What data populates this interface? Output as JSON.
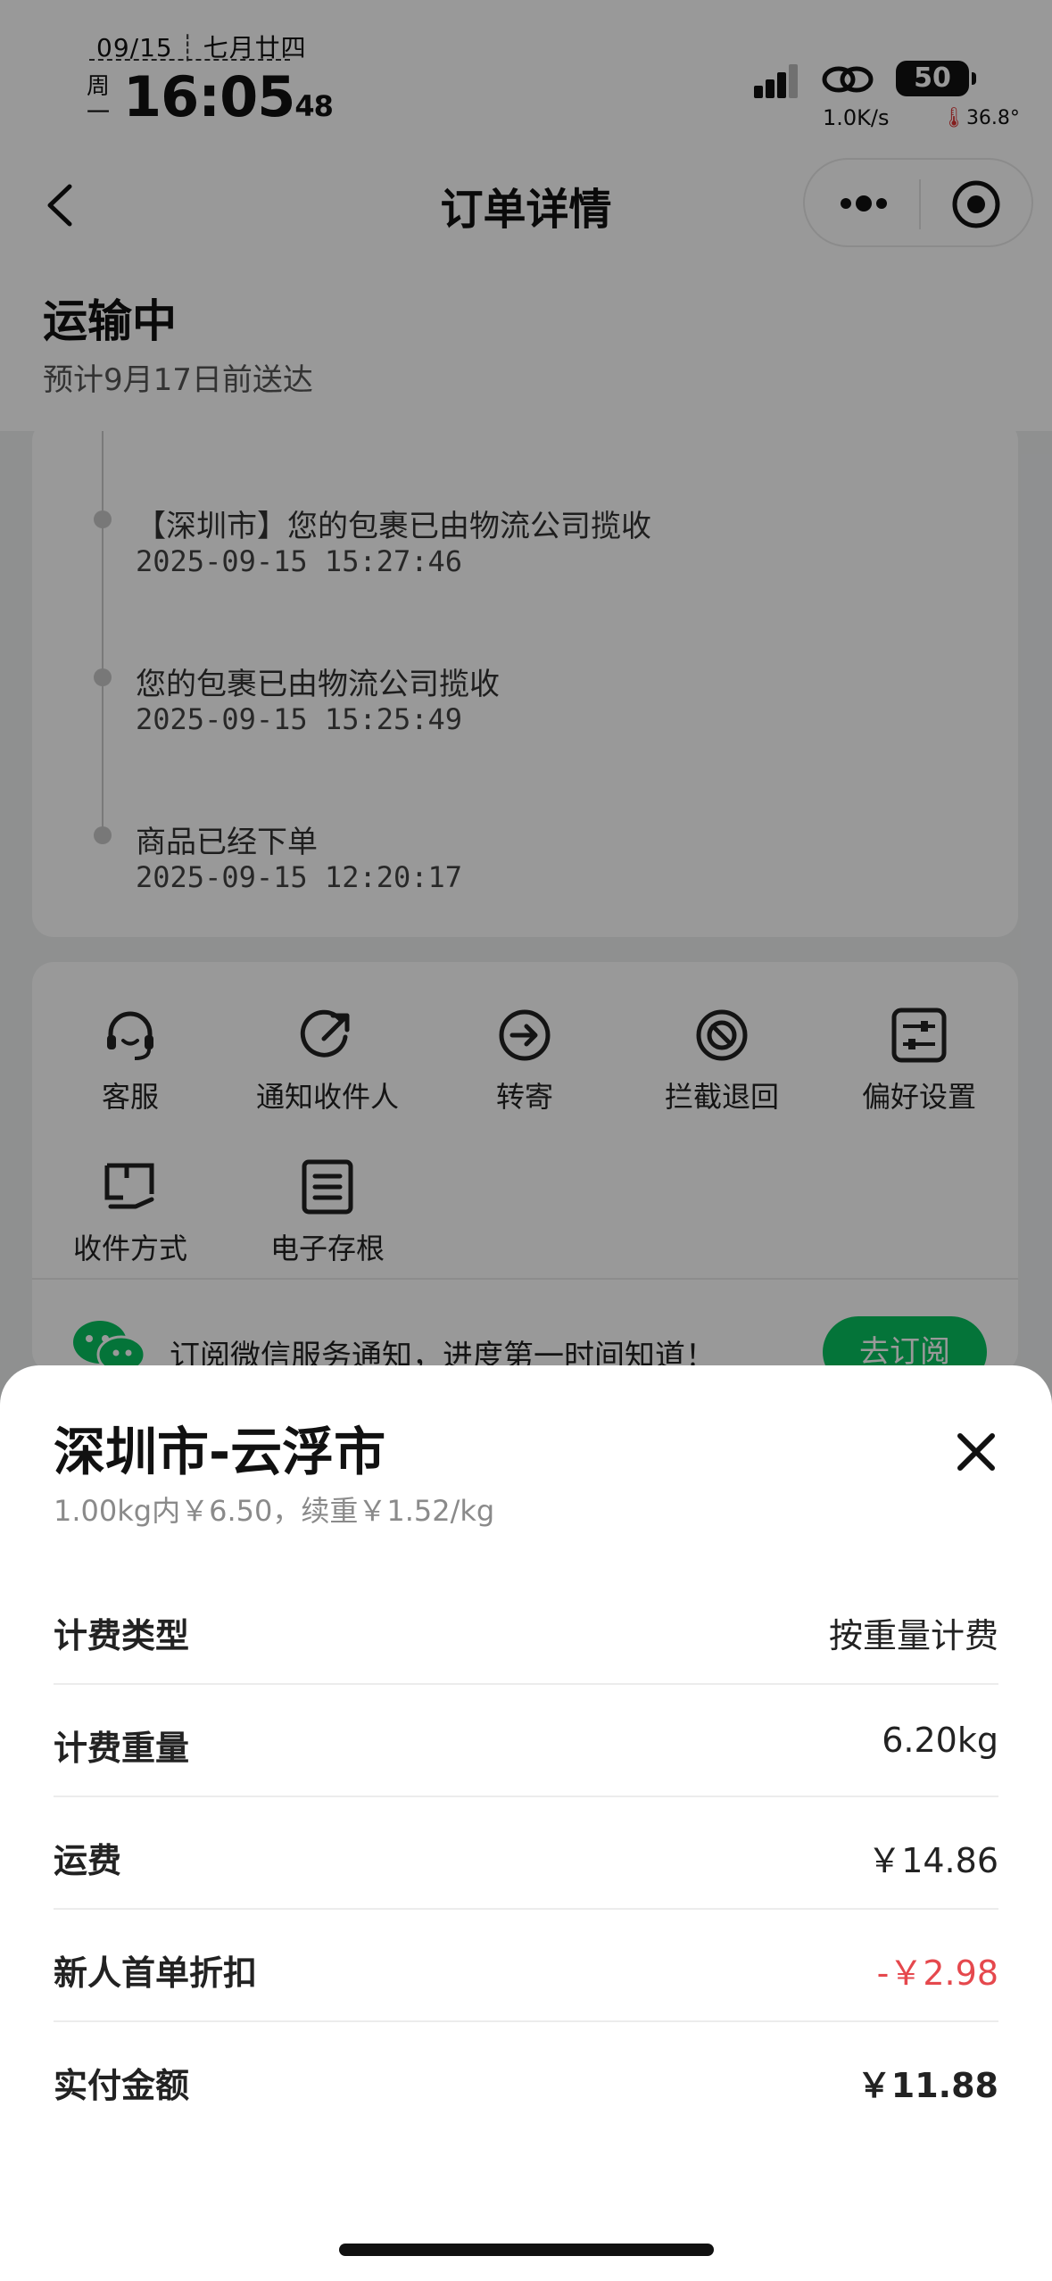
{
  "status_bar": {
    "date": "09/15",
    "lunar": "七月廿四",
    "weekday": "周一",
    "time": "16:05",
    "seconds": "48",
    "battery": "50",
    "net_speed": "1.0K/s",
    "temperature": "36.8°"
  },
  "nav": {
    "title": "订单详情"
  },
  "order_status": {
    "title": "运输中",
    "subtitle": "预计9月17日前送达"
  },
  "tracking": [
    {
      "text": "【深圳市】您的包裹已由物流公司揽收",
      "time": "2025-09-15 15:27:46"
    },
    {
      "text": "您的包裹已由物流公司揽收",
      "time": "2025-09-15 15:25:49"
    },
    {
      "text": "商品已经下单",
      "time": "2025-09-15 12:20:17"
    }
  ],
  "actions": [
    {
      "label": "客服",
      "icon": "headset-icon"
    },
    {
      "label": "通知收件人",
      "icon": "share-arrow-icon"
    },
    {
      "label": "转寄",
      "icon": "forward-icon"
    },
    {
      "label": "拦截退回",
      "icon": "block-icon"
    },
    {
      "label": "偏好设置",
      "icon": "sliders-icon"
    },
    {
      "label": "收件方式",
      "icon": "package-hand-icon"
    },
    {
      "label": "电子存根",
      "icon": "document-icon"
    }
  ],
  "subscribe": {
    "text": "订阅微信服务通知，进度第一时间知道！",
    "button": "去订阅"
  },
  "fee_sheet": {
    "title": "深圳市-云浮市",
    "subtitle": "1.00kg内￥6.50，续重￥1.52/kg",
    "rows": [
      {
        "label": "计费类型",
        "value": "按重量计费"
      },
      {
        "label": "计费重量",
        "value": "6.20kg"
      },
      {
        "label": "运费",
        "value": "￥14.86"
      },
      {
        "label": "新人首单折扣",
        "value": "-￥2.98"
      },
      {
        "label": "实付金额",
        "value": "￥11.88"
      }
    ]
  },
  "colors": {
    "accent_green": "#07c160",
    "discount_red": "#e5484d"
  }
}
